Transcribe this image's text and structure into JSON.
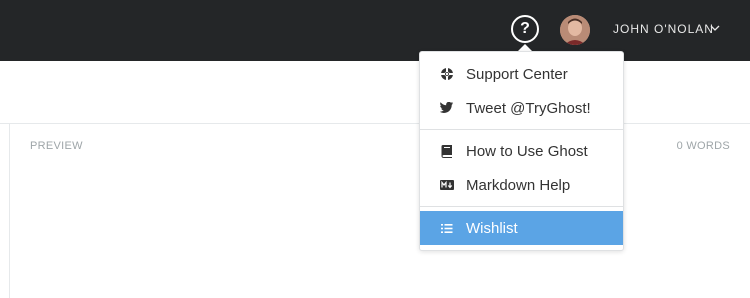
{
  "topbar": {
    "help_symbol": "?",
    "user_name": "JOHN O'NOLAN"
  },
  "editor": {
    "preview_label": "PREVIEW",
    "word_count": "0 WORDS"
  },
  "help_menu": {
    "items": [
      {
        "label": "Support Center",
        "icon": "lifebuoy-icon"
      },
      {
        "label": "Tweet @TryGhost!",
        "icon": "twitter-icon"
      },
      {
        "label": "How to Use Ghost",
        "icon": "book-icon"
      },
      {
        "label": "Markdown Help",
        "icon": "markdown-icon"
      },
      {
        "label": "Wishlist",
        "icon": "list-icon"
      }
    ],
    "active_item": "Wishlist"
  },
  "colors": {
    "topbar_bg": "#242628",
    "accent": "#5ba4e5",
    "muted_text": "#9ea5a8"
  }
}
